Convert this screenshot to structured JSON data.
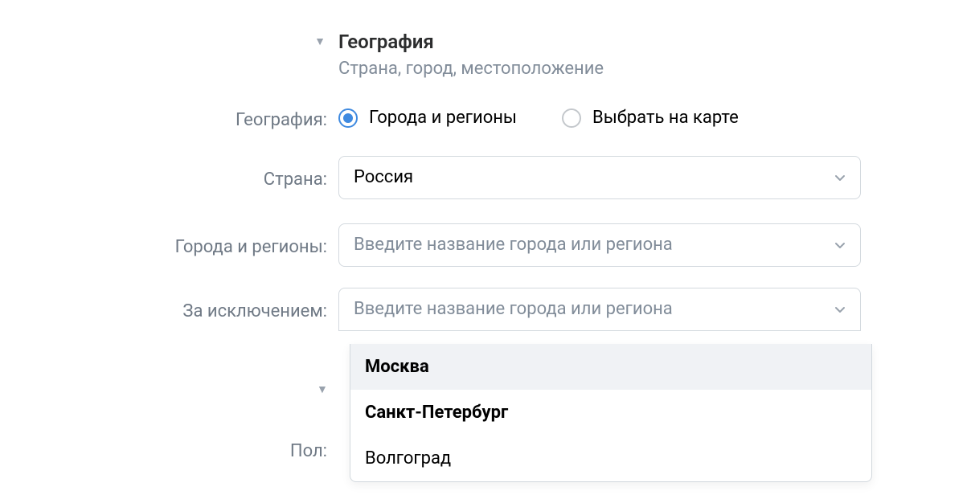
{
  "section": {
    "title": "География",
    "subtitle": "Страна, город, местоположение"
  },
  "geography": {
    "label": "География:",
    "option_cities": "Города и регионы",
    "option_map": "Выбрать на карте"
  },
  "country": {
    "label": "Страна:",
    "value": "Россия"
  },
  "cities_regions": {
    "label": "Города и регионы:",
    "placeholder": "Введите название города или региона"
  },
  "exclude": {
    "label": "За исключением:",
    "placeholder": "Введите название города или региона",
    "options": [
      {
        "label": "Москва",
        "bold": true,
        "highlight": true
      },
      {
        "label": "Санкт-Петербург",
        "bold": true,
        "highlight": false
      },
      {
        "label": "Волгоград",
        "bold": false,
        "highlight": false
      }
    ]
  },
  "gender": {
    "label": "Пол:"
  }
}
